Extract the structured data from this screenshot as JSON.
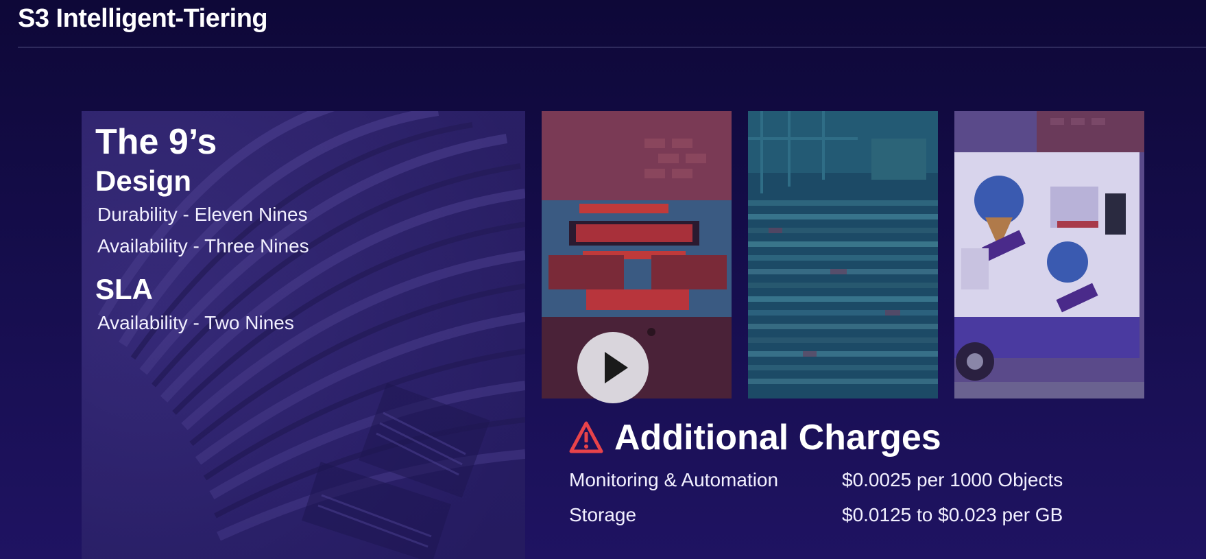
{
  "header": {
    "title": "S3 Intelligent-Tiering"
  },
  "nines_panel": {
    "heading": "The 9’s",
    "design": {
      "title": "Design",
      "lines": [
        "Durability - Eleven Nines",
        "Availability - Three Nines"
      ]
    },
    "sla": {
      "title": "SLA",
      "lines": [
        "Availability - Two Nines"
      ]
    }
  },
  "video_tiles": [
    {
      "icon": "car-taillight-image",
      "tint": "#6a2a4a"
    },
    {
      "icon": "shipping-containers-image",
      "tint": "#1c4f6a"
    },
    {
      "icon": "ice-cream-truck-image",
      "tint": "#5a4aa0"
    }
  ],
  "play_button": {
    "icon": "play-icon"
  },
  "additional_charges": {
    "icon": "warning-icon",
    "title": "Additional Charges",
    "rows": [
      {
        "label": "Monitoring & Automation",
        "value": "$0.0025 per 1000 Objects"
      },
      {
        "label": "Storage",
        "value": "$0.0125 to $0.023 per GB"
      }
    ]
  },
  "colors": {
    "background_top": "#0e0838",
    "background_bottom": "#1f1362",
    "warning": "#e8434a",
    "play_button": "#d9d5dc"
  }
}
